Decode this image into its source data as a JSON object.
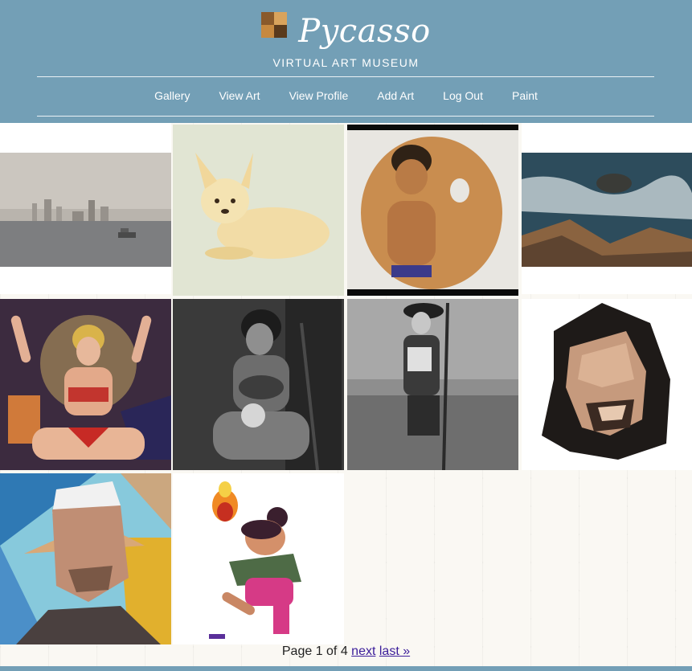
{
  "header": {
    "title": "Pycasso",
    "tagline": "VIRTUAL ART MUSEUM"
  },
  "nav": {
    "items": [
      {
        "label": "Gallery"
      },
      {
        "label": "View Art"
      },
      {
        "label": "View Profile"
      },
      {
        "label": "Add Art"
      },
      {
        "label": "Log Out"
      },
      {
        "label": "Paint"
      }
    ]
  },
  "gallery": {
    "artworks": [
      {
        "subject": "foggy-city-harbor"
      },
      {
        "subject": "chihuahua-drawing"
      },
      {
        "subject": "man-on-palette"
      },
      {
        "subject": "ocean-rocks"
      },
      {
        "subject": "woman-pop-art"
      },
      {
        "subject": "woman-with-skull"
      },
      {
        "subject": "cavalier-on-street"
      },
      {
        "subject": "lowpoly-portrait-longhair"
      },
      {
        "subject": "lowpoly-portrait-cap"
      },
      {
        "subject": "fire-girl-character"
      }
    ]
  },
  "pagination": {
    "text": "Page 1 of 4",
    "next_label": "next",
    "last_label": "last »"
  },
  "colors": {
    "header_bg": "#739fb6",
    "link": "#3b1d9a",
    "page_bg": "#faf8f3"
  }
}
